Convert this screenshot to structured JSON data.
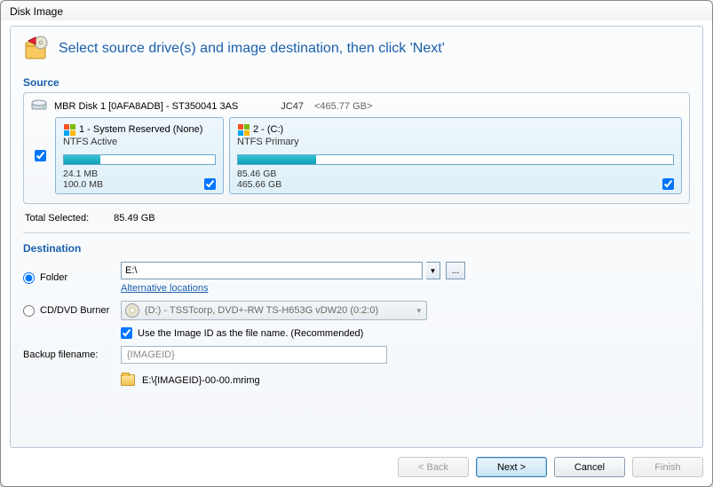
{
  "window": {
    "title": "Disk Image"
  },
  "header": {
    "title": "Select source drive(s) and image destination, then click 'Next'"
  },
  "source": {
    "label": "Source",
    "disk": {
      "name": "MBR Disk 1 [0AFA8ADB] - ST350041 3AS",
      "meta": "JC47",
      "size": "<465.77 GB>"
    },
    "partitions": [
      {
        "title": "1 - System Reserved (None)",
        "sub": "NTFS Active",
        "used": "24.1 MB",
        "total": "100.0 MB",
        "fillPercent": 24,
        "checked": true
      },
      {
        "title": "2 -  (C:)",
        "sub": "NTFS Primary",
        "used": "85.46 GB",
        "total": "465.66 GB",
        "fillPercent": 18,
        "checked": true
      }
    ],
    "selectAllChecked": true,
    "totalsLabel": "Total Selected:",
    "totalsValue": "85.49 GB"
  },
  "destination": {
    "label": "Destination",
    "folderRadio": "Folder",
    "folderValue": "E:\\",
    "altLink": "Alternative locations",
    "burnerRadio": "CD/DVD Burner",
    "burnerValue": "(D:) - TSSTcorp, DVD+-RW TS-H653G vDW20 (0:2:0)",
    "useImageIdLabel": "Use the Image ID as the file name.  (Recommended)",
    "useImageIdChecked": true,
    "backupLabel": "Backup filename:",
    "backupValue": "{IMAGEID}",
    "finalPath": "E:\\{IMAGEID}-00-00.mrimg"
  },
  "buttons": {
    "back": "< Back",
    "next": "Next >",
    "cancel": "Cancel",
    "finish": "Finish"
  }
}
